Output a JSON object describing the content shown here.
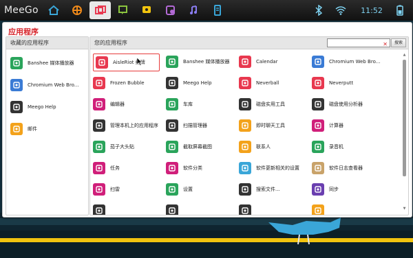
{
  "topbar": {
    "brand": "MeeGo",
    "zones": [
      {
        "name": "home-zone-icon"
      },
      {
        "name": "myzone-icon"
      },
      {
        "name": "applications-zone-icon",
        "active": true
      },
      {
        "name": "status-zone-icon"
      },
      {
        "name": "people-zone-icon"
      },
      {
        "name": "internet-zone-icon"
      },
      {
        "name": "media-zone-icon"
      },
      {
        "name": "devices-zone-icon"
      }
    ],
    "clock": "11:52"
  },
  "window": {
    "title": "应用程序",
    "favorites_header": "收藏的应用程序",
    "apps_header": "您的应用程序",
    "search_placeholder": "",
    "search_button": "搜索"
  },
  "favorites": [
    {
      "label": "Banshee 媒体播放器",
      "icon": "banshee-icon",
      "color": "#2aa45b"
    },
    {
      "label": "Chromium Web Bro...",
      "icon": "chromium-icon",
      "color": "#3a7bd5"
    },
    {
      "label": "Meego Help",
      "icon": "help-book-icon",
      "color": "#333333"
    },
    {
      "label": "邮件",
      "icon": "mail-icon",
      "color": "#f3a21b"
    }
  ],
  "apps": [
    {
      "label": "AisleRiot 纸牌",
      "icon": "cards-icon",
      "color": "#e8384f",
      "selected": true
    },
    {
      "label": "Banshee 媒体播放器",
      "icon": "banshee-icon",
      "color": "#2aa45b"
    },
    {
      "label": "Calendar",
      "icon": "calendar-icon",
      "color": "#e8384f"
    },
    {
      "label": "Chromium Web Bro...",
      "icon": "chromium-icon",
      "color": "#3a7bd5"
    },
    {
      "label": "Frozen Bubble",
      "icon": "bubble-icon",
      "color": "#e8384f"
    },
    {
      "label": "Meego Help",
      "icon": "help-book-icon",
      "color": "#333333"
    },
    {
      "label": "Neverball",
      "icon": "ball-icon",
      "color": "#e8384f"
    },
    {
      "label": "Neverputt",
      "icon": "flag-icon",
      "color": "#e8384f"
    },
    {
      "label": "编辑器",
      "icon": "editor-icon",
      "color": "#d01f7a"
    },
    {
      "label": "车库",
      "icon": "garage-icon",
      "color": "#2aa45b"
    },
    {
      "label": "磁盘实用工具",
      "icon": "disk-utility-icon",
      "color": "#333333"
    },
    {
      "label": "磁盘使用分析器",
      "icon": "disk-analyzer-icon",
      "color": "#333333"
    },
    {
      "label": "管理本机上的应用程序",
      "icon": "manage-apps-icon",
      "color": "#333333"
    },
    {
      "label": "扫描管理器",
      "icon": "scanner-icon",
      "color": "#333333"
    },
    {
      "label": "即时聊天工具",
      "icon": "chat-icon",
      "color": "#f3a21b"
    },
    {
      "label": "计算器",
      "icon": "calculator-icon",
      "color": "#d01f7a"
    },
    {
      "label": "茄子大头贴",
      "icon": "photobooth-icon",
      "color": "#2aa45b"
    },
    {
      "label": "截取屏幕截图",
      "icon": "screenshot-icon",
      "color": "#2aa45b"
    },
    {
      "label": "联系人",
      "icon": "contacts-icon",
      "color": "#f3a21b"
    },
    {
      "label": "录音机",
      "icon": "microphone-icon",
      "color": "#2aa45b"
    },
    {
      "label": "任务",
      "icon": "tasks-icon",
      "color": "#d01f7a"
    },
    {
      "label": "软件分类",
      "icon": "software-cat-icon",
      "color": "#d01f7a"
    },
    {
      "label": "软件更新相关的设置",
      "icon": "update-settings-icon",
      "color": "#3aa6d8"
    },
    {
      "label": "软件日志查看器",
      "icon": "log-viewer-icon",
      "color": "#c9a36a"
    },
    {
      "label": "扫雷",
      "icon": "mines-icon",
      "color": "#d01f7a"
    },
    {
      "label": "设置",
      "icon": "settings-icon",
      "color": "#2aa45b"
    },
    {
      "label": "搜索文件...",
      "icon": "search-files-icon",
      "color": "#333333"
    },
    {
      "label": "同步",
      "icon": "sync-icon",
      "color": "#6a3fb0"
    },
    {
      "label": "",
      "icon": "partial-icon",
      "color": "#333333"
    },
    {
      "label": "",
      "icon": "partial-icon",
      "color": "#333333"
    },
    {
      "label": "",
      "icon": "partial-icon",
      "color": "#333333"
    },
    {
      "label": "",
      "icon": "partial-icon",
      "color": "#f3a21b"
    }
  ]
}
